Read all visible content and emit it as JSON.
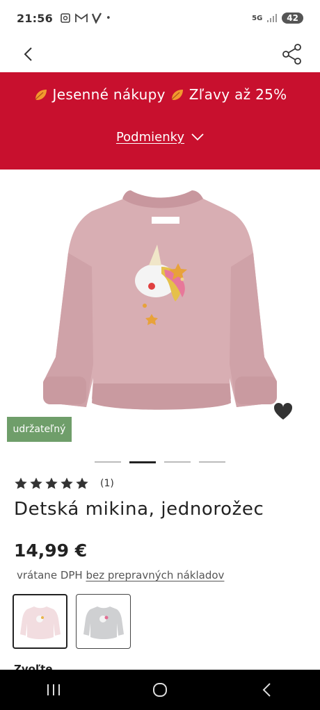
{
  "status_bar": {
    "time": "21:56",
    "left_icons": [
      "screenshot-icon",
      "gmail-icon",
      "v-app-icon"
    ],
    "dot": "•",
    "network_label": "5G",
    "battery": "42"
  },
  "header": {
    "back_icon": "chevron-left-icon",
    "share_icon": "share-icon"
  },
  "promo": {
    "text_1": "Jesenné nákupy",
    "text_2": "Zľavy až 25%",
    "conditions_label": "Podmienky",
    "background_color": "#c8102e"
  },
  "product": {
    "badge": "udržateľný",
    "badge_color": "#6f9e6a",
    "gallery_total": 4,
    "gallery_active": 2,
    "rating_stars": 5,
    "rating_count": "(1)",
    "title": "Detská mikina, jednorožec",
    "price": "14,99 €",
    "tax_prefix": "vrátane DPH",
    "shipping_link": "bez prepravných nákladov",
    "variants": [
      {
        "color": "pink",
        "selected": true
      },
      {
        "color": "grey",
        "selected": false
      }
    ]
  },
  "next_section_heading": "Zvoľte",
  "nav": {
    "recents_icon": "recents-icon",
    "home_icon": "home-icon",
    "back_icon": "back-icon"
  }
}
